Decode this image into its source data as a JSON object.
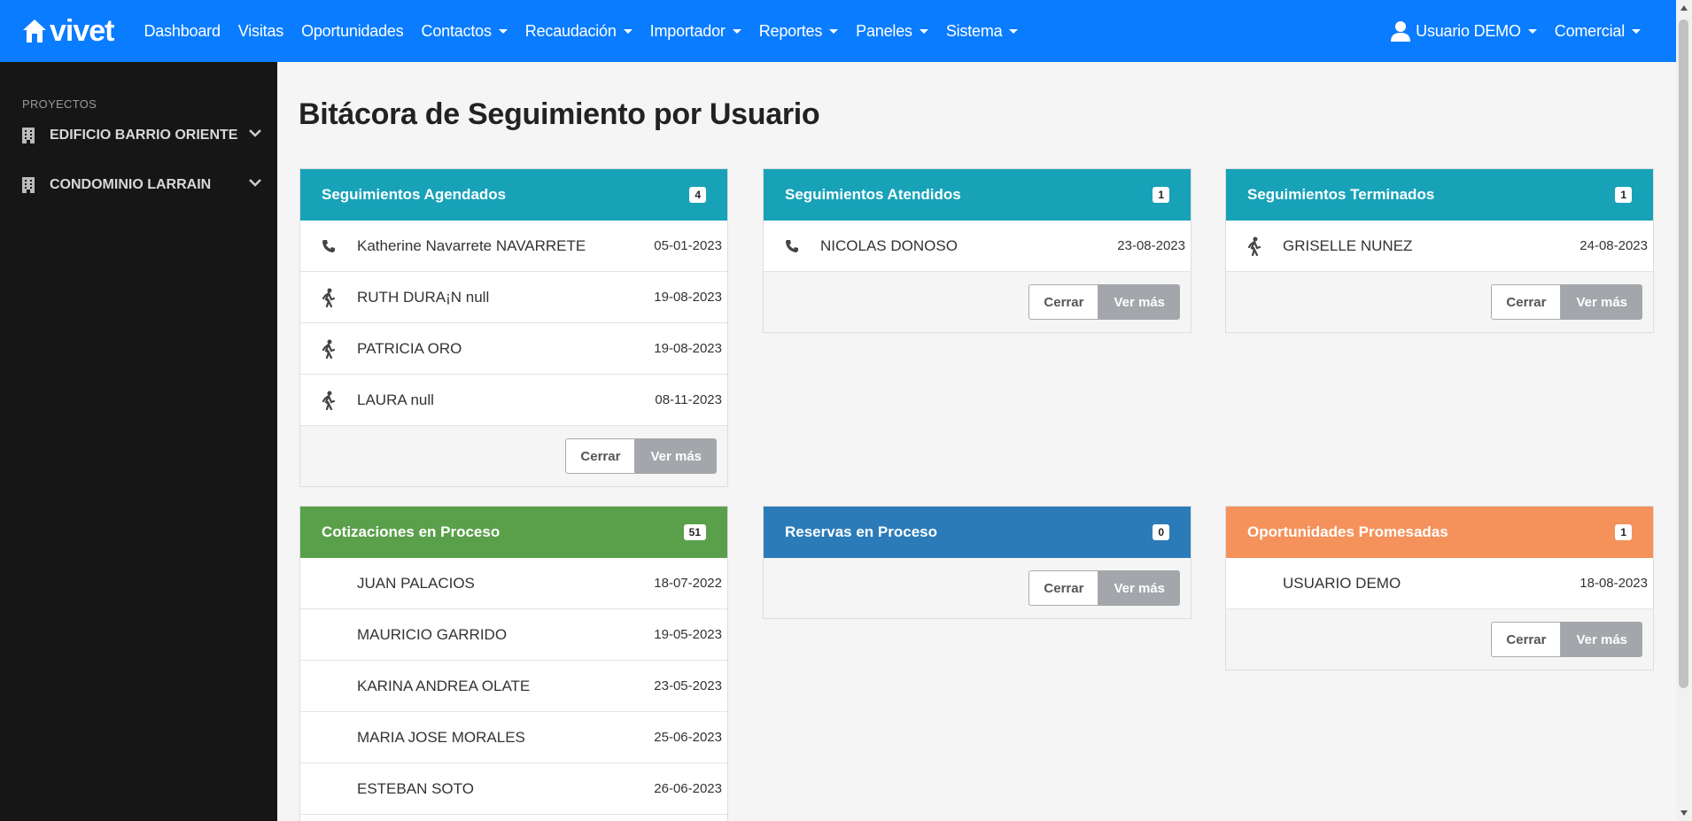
{
  "brand": {
    "name": "vivet"
  },
  "nav": {
    "items": [
      {
        "label": "Dashboard",
        "dropdown": false
      },
      {
        "label": "Visitas",
        "dropdown": false
      },
      {
        "label": "Oportunidades",
        "dropdown": false
      },
      {
        "label": "Contactos",
        "dropdown": true
      },
      {
        "label": "Recaudación",
        "dropdown": true
      },
      {
        "label": "Importador",
        "dropdown": true
      },
      {
        "label": "Reportes",
        "dropdown": true
      },
      {
        "label": "Paneles",
        "dropdown": true
      },
      {
        "label": "Sistema",
        "dropdown": true
      }
    ],
    "user_label": "Usuario DEMO",
    "role_label": "Comercial"
  },
  "sidebar": {
    "heading": "PROYECTOS",
    "items": [
      {
        "label": "EDIFICIO BARRIO ORIENTE"
      },
      {
        "label": "CONDOMINIO LARRAIN"
      }
    ]
  },
  "page": {
    "title": "Bitácora de Seguimiento por Usuario"
  },
  "buttons": {
    "close": "Cerrar",
    "more": "Ver más"
  },
  "panels": {
    "agendados": {
      "title": "Seguimientos Agendados",
      "count": "4",
      "color": "#17a2b8",
      "rows": [
        {
          "icon": "phone-icon",
          "name": "Katherine Navarrete NAVARRETE",
          "date": "05-01-2023"
        },
        {
          "icon": "walking-icon",
          "name": "RUTH DURA¡N null",
          "date": "19-08-2023"
        },
        {
          "icon": "walking-icon",
          "name": "PATRICIA ORO",
          "date": "19-08-2023"
        },
        {
          "icon": "walking-icon",
          "name": "LAURA null",
          "date": "08-11-2023"
        }
      ]
    },
    "atendidos": {
      "title": "Seguimientos Atendidos",
      "count": "1",
      "color": "#17a2b8",
      "rows": [
        {
          "icon": "phone-icon",
          "name": "NICOLAS DONOSO",
          "date": "23-08-2023"
        }
      ]
    },
    "terminados": {
      "title": "Seguimientos Terminados",
      "count": "1",
      "color": "#17a2b8",
      "rows": [
        {
          "icon": "walking-icon",
          "name": "GRISELLE NUNEZ",
          "date": "24-08-2023"
        }
      ]
    },
    "cotizaciones": {
      "title": "Cotizaciones en Proceso",
      "count": "51",
      "color": "#5a9f4a",
      "rows": [
        {
          "name": "JUAN PALACIOS",
          "date": "18-07-2022"
        },
        {
          "name": "MAURICIO GARRIDO",
          "date": "19-05-2023"
        },
        {
          "name": "KARINA ANDREA OLATE",
          "date": "23-05-2023"
        },
        {
          "name": "MARIA JOSE MORALES",
          "date": "25-06-2023"
        },
        {
          "name": "ESTEBAN SOTO",
          "date": "26-06-2023"
        }
      ]
    },
    "reservas": {
      "title": "Reservas en Proceso",
      "count": "0",
      "color": "#2b7bb9",
      "rows": []
    },
    "promesadas": {
      "title": "Oportunidades Promesadas",
      "count": "1",
      "color": "#f5915a",
      "rows": [
        {
          "name": "USUARIO DEMO",
          "date": "18-08-2023"
        }
      ]
    }
  }
}
